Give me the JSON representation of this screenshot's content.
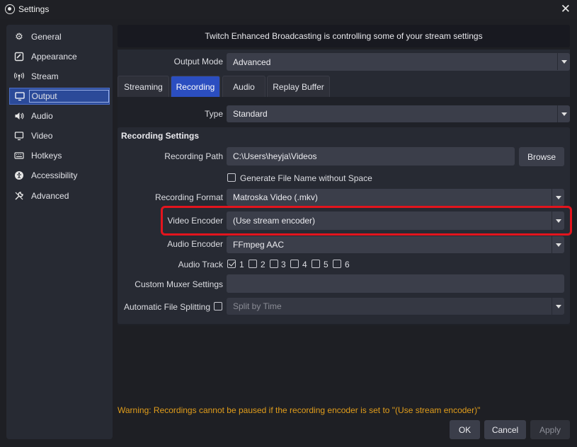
{
  "window": {
    "title": "Settings",
    "close_glyph": "✕"
  },
  "sidebar": {
    "items": [
      {
        "label": "General",
        "icon": "gear-icon"
      },
      {
        "label": "Appearance",
        "icon": "appearance-icon"
      },
      {
        "label": "Stream",
        "icon": "broadcast-icon"
      },
      {
        "label": "Output",
        "icon": "monitor-icon",
        "active": true
      },
      {
        "label": "Audio",
        "icon": "speaker-icon"
      },
      {
        "label": "Video",
        "icon": "screen-icon"
      },
      {
        "label": "Hotkeys",
        "icon": "keyboard-icon"
      },
      {
        "label": "Accessibility",
        "icon": "accessibility-icon"
      },
      {
        "label": "Advanced",
        "icon": "wrench-icon"
      }
    ]
  },
  "banner": {
    "text": "Twitch Enhanced Broadcasting is controlling some of your stream settings"
  },
  "output_mode": {
    "label": "Output Mode",
    "value": "Advanced"
  },
  "tabs": [
    {
      "label": "Streaming"
    },
    {
      "label": "Recording",
      "active": true
    },
    {
      "label": "Audio"
    },
    {
      "label": "Replay Buffer"
    }
  ],
  "type": {
    "label": "Type",
    "value": "Standard"
  },
  "recording_settings": {
    "title": "Recording Settings",
    "path_label": "Recording Path",
    "path_value": "C:\\Users\\heyja\\Videos",
    "browse_label": "Browse",
    "generate_name_label": "Generate File Name without Space",
    "generate_name_checked": false,
    "format_label": "Recording Format",
    "format_value": "Matroska Video (.mkv)",
    "video_encoder_label": "Video Encoder",
    "video_encoder_value": "(Use stream encoder)",
    "audio_encoder_label": "Audio Encoder",
    "audio_encoder_value": "FFmpeg AAC",
    "audio_track_label": "Audio Track",
    "audio_tracks": [
      {
        "label": "1",
        "checked": true
      },
      {
        "label": "2",
        "checked": false
      },
      {
        "label": "3",
        "checked": false
      },
      {
        "label": "4",
        "checked": false
      },
      {
        "label": "5",
        "checked": false
      },
      {
        "label": "6",
        "checked": false
      }
    ],
    "muxer_label": "Custom Muxer Settings",
    "muxer_value": "",
    "splitting_label": "Automatic File Splitting",
    "splitting_checked": false,
    "splitting_value": "Split by Time"
  },
  "warning": "Warning: Recordings cannot be paused if the recording encoder is set to \"(Use stream encoder)\"",
  "buttons": {
    "ok": "OK",
    "cancel": "Cancel",
    "apply": "Apply"
  },
  "colors": {
    "highlight": "#e3141d",
    "accent": "#2b4ec0",
    "warning": "#e19d1b"
  }
}
